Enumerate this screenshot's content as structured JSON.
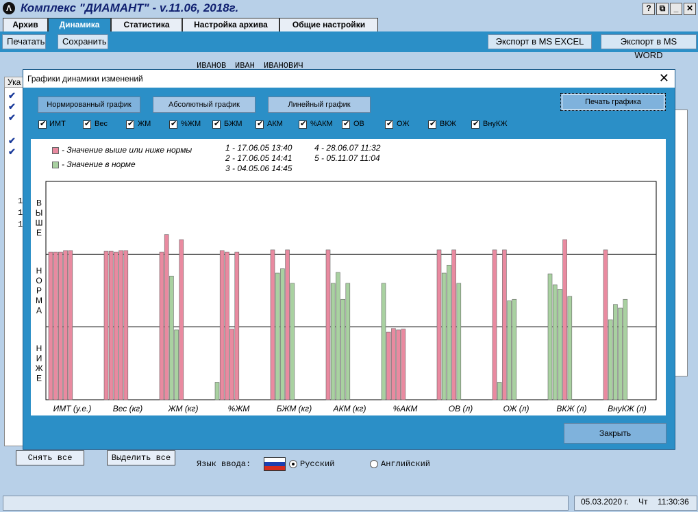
{
  "app": {
    "title": "Комплекс \"ДИАМАНТ\"  -  v.11.06, 2018г.",
    "logo_letter": "Λ",
    "help": "?",
    "restore": "⧉",
    "minimize": "_",
    "close": "✕"
  },
  "tabs": [
    "Архив",
    "Динамика",
    "Статистика",
    "Настройка архива",
    "Общие настройки"
  ],
  "toolbar": {
    "print": "Печатать",
    "save": "Сохранить",
    "excel": "Экспорт в MS EXCEL",
    "word": "Экспорт в MS WORD"
  },
  "background": {
    "person": [
      "ИВАНОВ",
      "ИВАН",
      "ИВАНОВИЧ"
    ],
    "ukaz": "Ука",
    "check": "✔",
    "digits": [
      "1",
      "1",
      "1"
    ],
    "deselect_all": "Снять все",
    "select_all": "Выделить все",
    "lang_label": "Язык ввода:",
    "lang_ru": "Русский",
    "lang_en": "Английский"
  },
  "status": {
    "date": "05.03.2020 г.",
    "weekday": "Чт",
    "time": "11:30:36"
  },
  "dialog": {
    "title": "Графики динамики изменений",
    "close_x": "✕",
    "graph_buttons": [
      "Нормированный график",
      "Абсолютный график",
      "Линейный график"
    ],
    "print_graph": "Печать графика",
    "checkboxes": [
      "ИМТ",
      "Вес",
      "ЖМ",
      "%ЖМ",
      "БЖМ",
      "АКМ",
      "%АКМ",
      "ОВ",
      "ОЖ",
      "ВКЖ",
      "ВнуКЖ"
    ],
    "close_button": "Закрыть"
  },
  "chart_data": {
    "type": "bar",
    "legend": [
      {
        "label": "- Значение выше или ниже нормы",
        "color": "#e98aa0"
      },
      {
        "label": "- Значение в норме",
        "color": "#a9d1a1"
      }
    ],
    "dates": [
      "1  -  17.06.05  13:40",
      "2  -  17.06.05  14:41",
      "3  -  04.05.06  14:45",
      "4  -  28.06.07  11:32",
      "5  -  05.11.07  11:04"
    ],
    "ylabels": {
      "high": "ВЫШЕ",
      "norm": "НОРМА",
      "low": "НИЖЕ"
    },
    "zones": [
      "ниже",
      "норма",
      "выше"
    ],
    "categories": [
      "ИМТ (у.е.)",
      "Вес (кг)",
      "ЖМ (кг)",
      "%ЖМ",
      "БЖМ (кг)",
      "АКМ (кг)",
      "%АКМ",
      "ОВ (л)",
      "ОЖ (л)",
      "ВКЖ (л)",
      "ВнуКЖ (л)"
    ],
    "series": [
      {
        "values": [
          2.03,
          2.04,
          2.03,
          0.24,
          2.06,
          2.06,
          1.6,
          2.06,
          2.06,
          1.73,
          2.06
        ],
        "status": [
          "out",
          "out",
          "out",
          "in",
          "out",
          "out",
          "in",
          "out",
          "out",
          "in",
          "out"
        ]
      },
      {
        "values": [
          2.03,
          2.04,
          2.27,
          2.05,
          1.74,
          1.6,
          0.93,
          1.74,
          0.24,
          1.58,
          1.1
        ],
        "status": [
          "out",
          "out",
          "out",
          "out",
          "in",
          "in",
          "out",
          "in",
          "in",
          "in",
          "in"
        ]
      },
      {
        "values": [
          2.03,
          2.03,
          1.7,
          2.03,
          1.8,
          1.75,
          0.98,
          1.85,
          2.06,
          1.52,
          1.31
        ],
        "status": [
          "out",
          "out",
          "in",
          "out",
          "in",
          "in",
          "out",
          "in",
          "out",
          "in",
          "in"
        ]
      },
      {
        "values": [
          2.05,
          2.05,
          0.96,
          0.97,
          2.06,
          1.38,
          0.96,
          2.06,
          1.36,
          2.2,
          1.26
        ],
        "status": [
          "out",
          "out",
          "in",
          "out",
          "out",
          "in",
          "out",
          "out",
          "in",
          "out",
          "in"
        ]
      },
      {
        "values": [
          2.05,
          2.05,
          2.2,
          2.03,
          1.6,
          1.6,
          0.97,
          1.6,
          1.38,
          1.42,
          1.38
        ],
        "status": [
          "out",
          "out",
          "out",
          "out",
          "in",
          "in",
          "out",
          "in",
          "in",
          "in",
          "in"
        ]
      }
    ]
  }
}
